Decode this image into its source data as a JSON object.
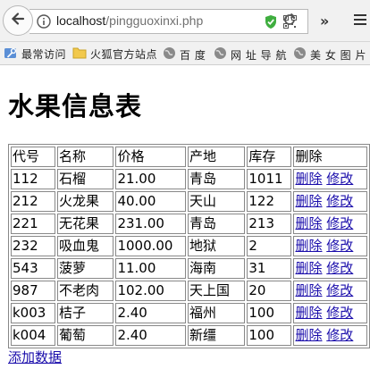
{
  "browser": {
    "url_host": "localhost",
    "url_path": "/pingguoxinxi.php"
  },
  "bookmarks": [
    {
      "label": "最常访问",
      "icon": "star-folder-icon"
    },
    {
      "label": "火狐官方站点",
      "icon": "folder-icon"
    },
    {
      "label": "百 度",
      "icon": "globe-icon"
    },
    {
      "label": "网 址 导 航",
      "icon": "globe-icon"
    },
    {
      "label": "美 女 图 片",
      "icon": "globe-icon"
    }
  ],
  "page": {
    "title": "水果信息表",
    "add_link": "添加数据"
  },
  "table": {
    "headers": [
      "代号",
      "名称",
      "价格",
      "产地",
      "库存",
      "删除"
    ],
    "delete_label": "删除",
    "edit_label": "修改",
    "rows": [
      [
        "112",
        "石榴",
        "21.00",
        "青岛",
        "1011"
      ],
      [
        "212",
        "火龙果",
        "40.00",
        "天山",
        "122"
      ],
      [
        "221",
        "无花果",
        "231.00",
        "青岛",
        "213"
      ],
      [
        "232",
        "吸血鬼",
        "1000.00",
        "地狱",
        "2"
      ],
      [
        "543",
        "菠萝",
        "11.00",
        "海南",
        "31"
      ],
      [
        "987",
        "不老肉",
        "102.00",
        "天上国",
        "20"
      ],
      [
        "k003",
        "桔子",
        "2.40",
        "福州",
        "100"
      ],
      [
        "k004",
        "葡萄",
        "2.40",
        "新缰",
        "100"
      ]
    ]
  },
  "colors": {
    "link": "#1a0dab",
    "chrome": "#f1f1f1",
    "border": "#888888"
  }
}
